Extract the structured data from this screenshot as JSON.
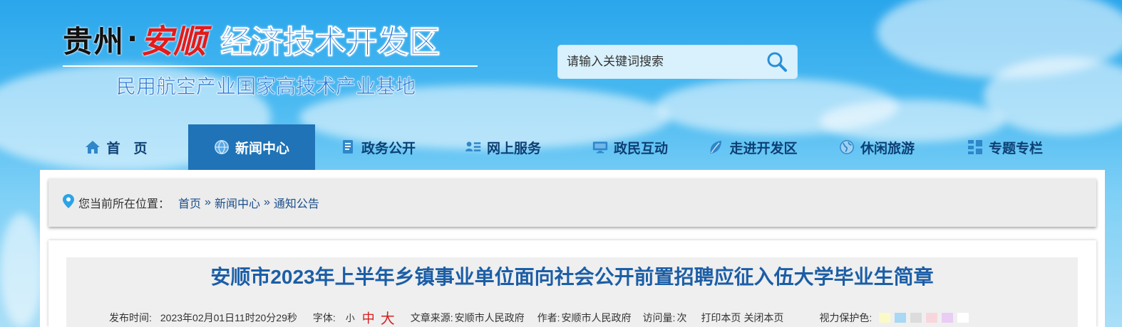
{
  "logo": {
    "part1": "贵州",
    "dot": "·",
    "part2": "安顺",
    "part3": "经济技术开发区",
    "subtitle": "民用航空产业国家高技术产业基地"
  },
  "search": {
    "placeholder": "请输入关键词搜索",
    "icon": "search-icon"
  },
  "nav": [
    {
      "label": "首　页",
      "icon": "home-icon",
      "active": false
    },
    {
      "label": "新闻中心",
      "icon": "globe-icon",
      "active": true
    },
    {
      "label": "政务公开",
      "icon": "document-icon",
      "active": false
    },
    {
      "label": "网上服务",
      "icon": "people-list-icon",
      "active": false
    },
    {
      "label": "政民互动",
      "icon": "monitor-icon",
      "active": false
    },
    {
      "label": "走进开发区",
      "icon": "leaf-icon",
      "active": false
    },
    {
      "label": "休闲旅游",
      "icon": "earth-icon",
      "active": false
    },
    {
      "label": "专题专栏",
      "icon": "grid-icon",
      "active": false
    }
  ],
  "breadcrumb": {
    "prefix": "您当前所在位置：",
    "items": [
      "首页",
      "新闻中心",
      "通知公告"
    ],
    "separator": "»"
  },
  "article": {
    "title": "安顺市2023年上半年乡镇事业单位面向社会公开前置招聘应征入伍大学毕业生简章",
    "publish_label": "发布时间:",
    "publish_time": "2023年02月01日11时20分29秒",
    "font_label": "字体:",
    "font_small": "小",
    "font_medium": "中",
    "font_large": "大",
    "source_label": "文章来源:",
    "source": "安顺市人民政府",
    "author_label": "作者:",
    "author": "安顺市人民政府",
    "visits_label": "访问量:",
    "visits_unit": "次",
    "print": "打印本页",
    "close": "关闭本页",
    "eye_label": "视力保护色:",
    "eye_colors": [
      "#fafac8",
      "#a8d8f3",
      "#dcdcdc",
      "#f8d7dc",
      "#e9cdf5",
      "#ffffff"
    ]
  },
  "colors": {
    "nav_active": "#1f73b6",
    "nav_text": "#0d3f73",
    "title_blue": "#1c5ea6"
  }
}
